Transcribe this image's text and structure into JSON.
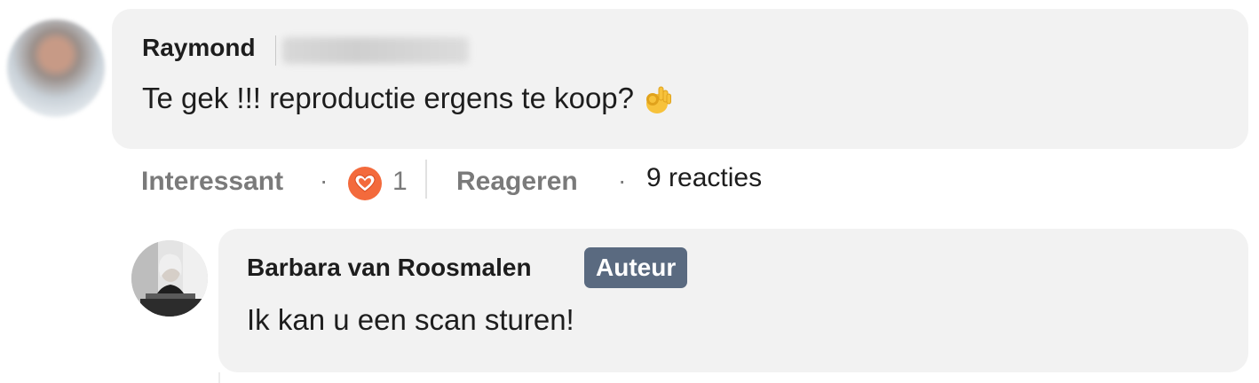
{
  "comment": {
    "author_first": "Raymond",
    "text": "Te gek !!! reproductie ergens te koop?",
    "emoji": "ok-hand-emoji"
  },
  "actions": {
    "interesting": "Interessant",
    "separator": "·",
    "like_count": "1",
    "reply": "Reageren",
    "replies": "9 reacties"
  },
  "reply": {
    "author": "Barbara van Roosmalen",
    "badge": "Auteur",
    "text": "Ik kan u een scan sturen!"
  },
  "colors": {
    "bubble": "#f2f2f2",
    "badge": "#5a6a80",
    "heart": "#f36a3c",
    "muted": "#7a7a7a"
  }
}
